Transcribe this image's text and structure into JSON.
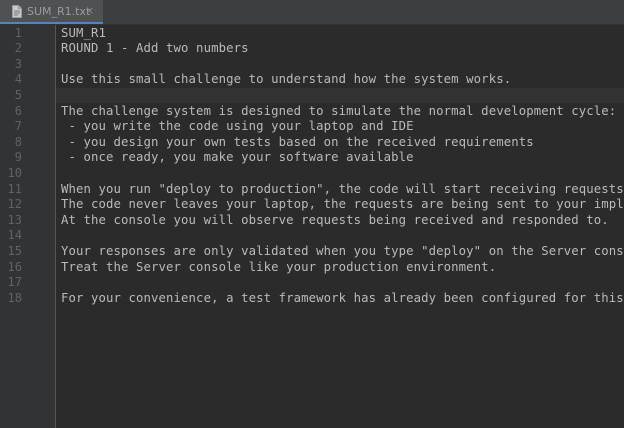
{
  "tab": {
    "file_name": "SUM_R1.txt",
    "file_icon": "text-file-icon",
    "close_label": "×",
    "close_icon": "close-icon"
  },
  "editor": {
    "caret_line": 5,
    "lines": [
      {
        "number": "1",
        "text": "SUM_R1"
      },
      {
        "number": "2",
        "text": "ROUND 1 - Add two numbers"
      },
      {
        "number": "3",
        "text": ""
      },
      {
        "number": "4",
        "text": "Use this small challenge to understand how the system works."
      },
      {
        "number": "5",
        "text": ""
      },
      {
        "number": "6",
        "text": "The challenge system is designed to simulate the normal development cycle:"
      },
      {
        "number": "7",
        "text": " - you write the code using your laptop and IDE"
      },
      {
        "number": "8",
        "text": " - you design your own tests based on the received requirements"
      },
      {
        "number": "9",
        "text": " - once ready, you make your software available"
      },
      {
        "number": "10",
        "text": ""
      },
      {
        "number": "11",
        "text": "When you run \"deploy to production\", the code will start receiving requests"
      },
      {
        "number": "12",
        "text": "The code never leaves your laptop, the requests are being sent to your imple"
      },
      {
        "number": "13",
        "text": "At the console you will observe requests being received and responded to."
      },
      {
        "number": "14",
        "text": ""
      },
      {
        "number": "15",
        "text": "Your responses are only validated when you type \"deploy\" on the Server conso"
      },
      {
        "number": "16",
        "text": "Treat the Server console like your production environment."
      },
      {
        "number": "17",
        "text": ""
      },
      {
        "number": "18",
        "text": "For your convenience, a test framework has already been configured for this"
      }
    ]
  },
  "colors": {
    "background": "#2b2b2b",
    "gutter": "#313335",
    "text": "#bababa",
    "line_number": "#606366",
    "tab_active_underline": "#4a88c7"
  }
}
